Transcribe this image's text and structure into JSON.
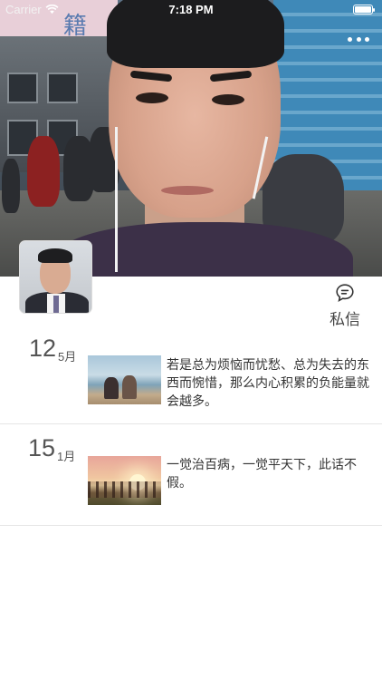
{
  "status_bar": {
    "carrier": "Carrier",
    "time": "7:18 PM"
  },
  "profile": {
    "cover_sign_text": "籍"
  },
  "actions": {
    "message_label": "私信"
  },
  "posts": [
    {
      "day": "12",
      "month": "5月",
      "thumbnail": "beach-two-people-photo",
      "text": "若是总为烦恼而忧愁、总为失去的东西而惋惜，那么内心积累的负能量就会越多。"
    },
    {
      "day": "15",
      "month": "1月",
      "thumbnail": "sunset-trees-photo",
      "text": "一觉治百病，一觉平天下，此话不假。"
    }
  ],
  "colors": {
    "divider": "#e6e6e6",
    "text": "#333333",
    "date_text": "#555555"
  },
  "icons": {
    "message": "chat-bubble-icon",
    "more": "more-dots-icon",
    "wifi": "wifi-icon",
    "battery": "battery-icon"
  }
}
